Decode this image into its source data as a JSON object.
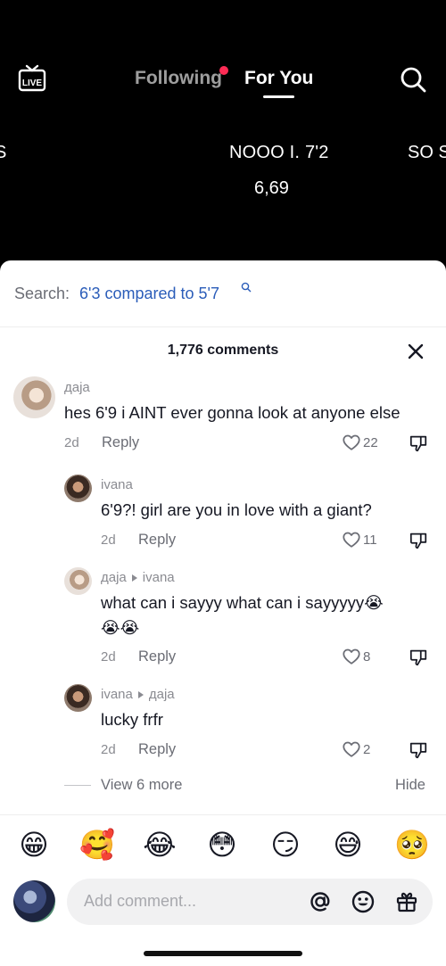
{
  "top_nav": {
    "live_label": "LIVE",
    "tabs": [
      {
        "label": "Following",
        "active": false,
        "has_notification": true
      },
      {
        "label": "For You",
        "active": true
      }
    ]
  },
  "video_overlay": {
    "left_fragment": "S",
    "main_caption": "NOOO I. 7'2",
    "number": "6,69",
    "right_fragment": "SO S"
  },
  "related_search": {
    "label": "Search:",
    "query": "6'3 compared to 5'7"
  },
  "comments_header": {
    "count_text": "1,776 comments"
  },
  "comments": [
    {
      "username": "даја",
      "text": "hes 6'9 i AINT ever gonna look at anyone else",
      "age": "2d",
      "reply_label": "Reply",
      "likes": "22"
    },
    {
      "username": "ivana",
      "text": "6'9?! girl are you in love with a giant?",
      "age": "2d",
      "reply_label": "Reply",
      "likes": "11"
    },
    {
      "username": "даја",
      "reply_to": "ivana",
      "text": "what can i sayyy what can i sayyyyy😭",
      "text_line2": "😭😭",
      "age": "2d",
      "reply_label": "Reply",
      "likes": "8"
    },
    {
      "username": "ivana",
      "reply_to": "даја",
      "text": "lucky frfr",
      "age": "2d",
      "reply_label": "Reply",
      "likes": "2"
    }
  ],
  "thread_controls": {
    "view_more": "View 6 more",
    "hide": "Hide"
  },
  "emoji_bar": [
    "😁",
    "🥰",
    "😂",
    "😳",
    "😏",
    "😅",
    "🥺"
  ],
  "composer": {
    "placeholder": "Add comment..."
  },
  "icons": {
    "top": [
      "live-icon",
      "search-icon"
    ],
    "composer": [
      "at-mention-icon",
      "emoji-icon",
      "gift-icon"
    ],
    "comment_actions": [
      "heart-icon",
      "dislike-icon"
    ]
  },
  "colors": {
    "accent_red": "#fe2c55",
    "search_link": "#2b5db9",
    "text_primary": "#161823",
    "text_secondary": "#8a8b91"
  }
}
